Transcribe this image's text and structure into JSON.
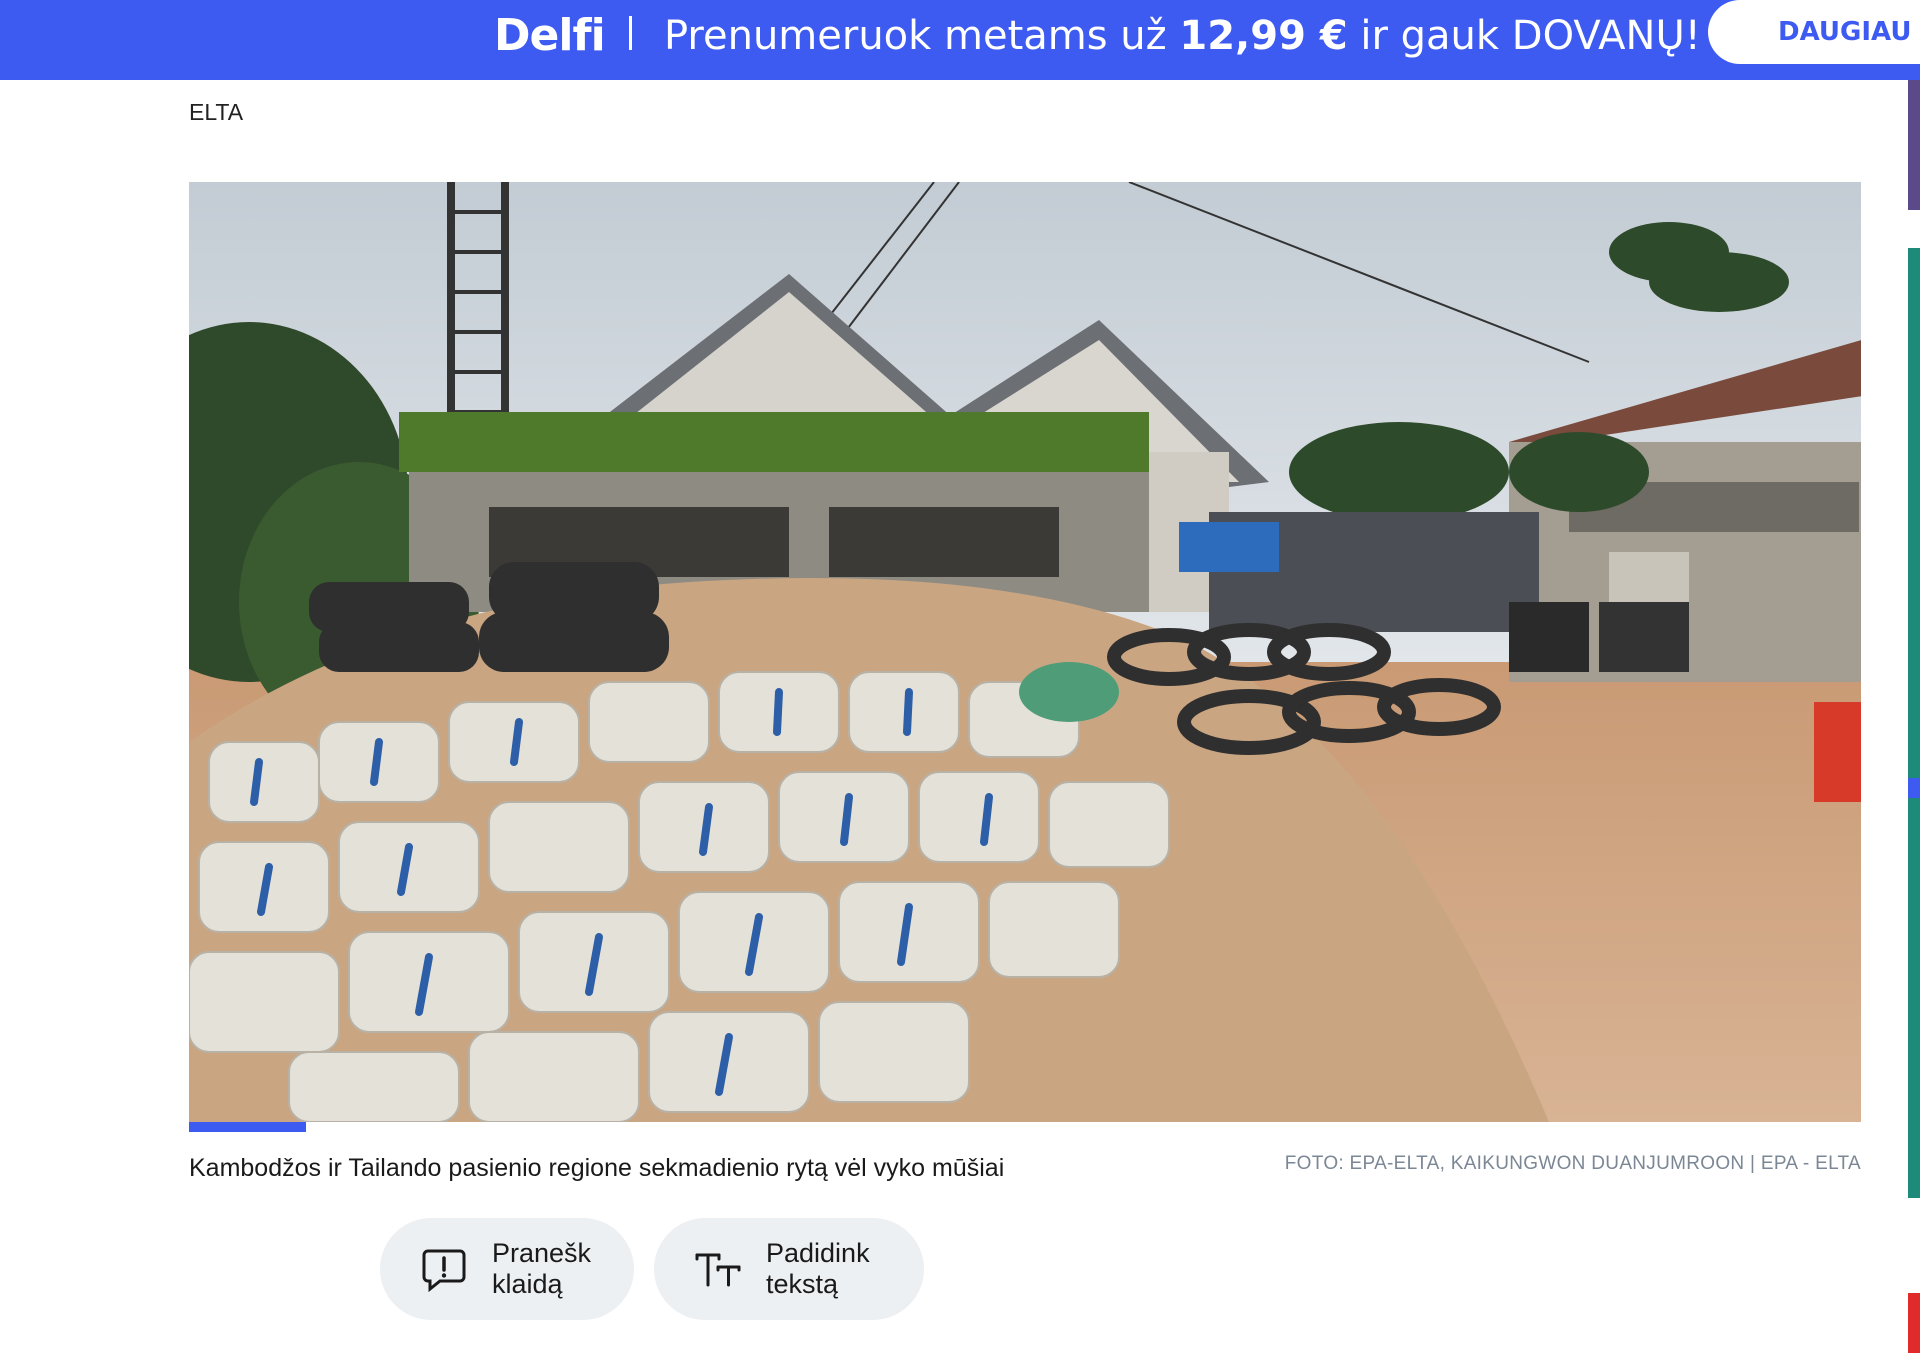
{
  "promo": {
    "brand": "Delfi",
    "headline_pre": "Prenumeruok metams už ",
    "headline_price": "12,99 €",
    "headline_post": " ir gauk DOVANŲ!",
    "more_label": "DAUGIAU",
    "background_color": "#3d5af1"
  },
  "article": {
    "source": "ELTA",
    "photo_caption": "Kambodžos ir Tailando pasienio regione sekmadienio rytą vėl vyko mūšiai",
    "photo_credit": "FOTO: EPA-ELTA, KAIKUNGWON DUANJUMROON | EPA - ELTA",
    "gallery_progress": 0.07
  },
  "actions": {
    "report_error": {
      "label_line1": "Pranešk",
      "label_line2": "klaidą",
      "icon": "report-icon"
    },
    "enlarge_text": {
      "label_line1": "Padidink",
      "label_line2": "tekstą",
      "icon": "text-size-icon"
    }
  }
}
